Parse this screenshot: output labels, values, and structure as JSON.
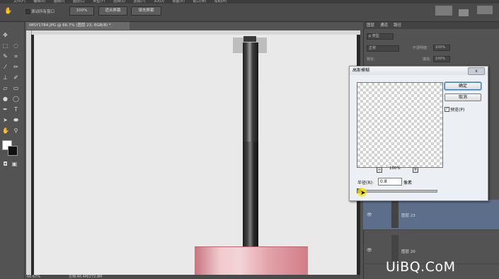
{
  "menu": {
    "items": [
      "文件(F)",
      "编辑(E)",
      "图像(I)",
      "图层(L)",
      "类型(Y)",
      "选择(S)",
      "滤镜(T)",
      "3D(D)",
      "视图(V)",
      "窗口(W)",
      "帮助(H)"
    ]
  },
  "options_bar": {
    "scroll_all_windows": "滚动所有窗口",
    "zoom_100": "100%",
    "fit_screen": "适合屏幕",
    "fill_screen": "填充屏幕"
  },
  "document": {
    "tab_label": "IMSY1784.JPG @ 66.7% (图层 23, RGB/8) *",
    "zoom": "66.67%",
    "doc_info": "文档:46.4M/272.8M"
  },
  "panel": {
    "tabs": [
      "图层",
      "通道",
      "路径"
    ],
    "filter_kind": "p 类型",
    "blend_mode": "正常",
    "opacity_label": "不透明度:",
    "opacity_value": "100%",
    "lock_label": "锁定:",
    "fill_label": "填充:",
    "fill_value": "100%",
    "layers": [
      {
        "name": "图层 23",
        "selected": true
      },
      {
        "name": "图层 20",
        "selected": false
      }
    ]
  },
  "dialog": {
    "title": "高斯模糊",
    "close": "x",
    "ok": "确定",
    "cancel": "取消",
    "preview_label": "预览(P)",
    "preview_checked": "✓",
    "zoom": "100%",
    "zoom_out": "−",
    "zoom_in": "+",
    "radius_label": "半径(R):",
    "radius_value": "0.8",
    "unit": "像素"
  },
  "watermark": "UiBQ.CoM",
  "colors": {
    "foreground": "#ffffff",
    "background": "#111111"
  }
}
